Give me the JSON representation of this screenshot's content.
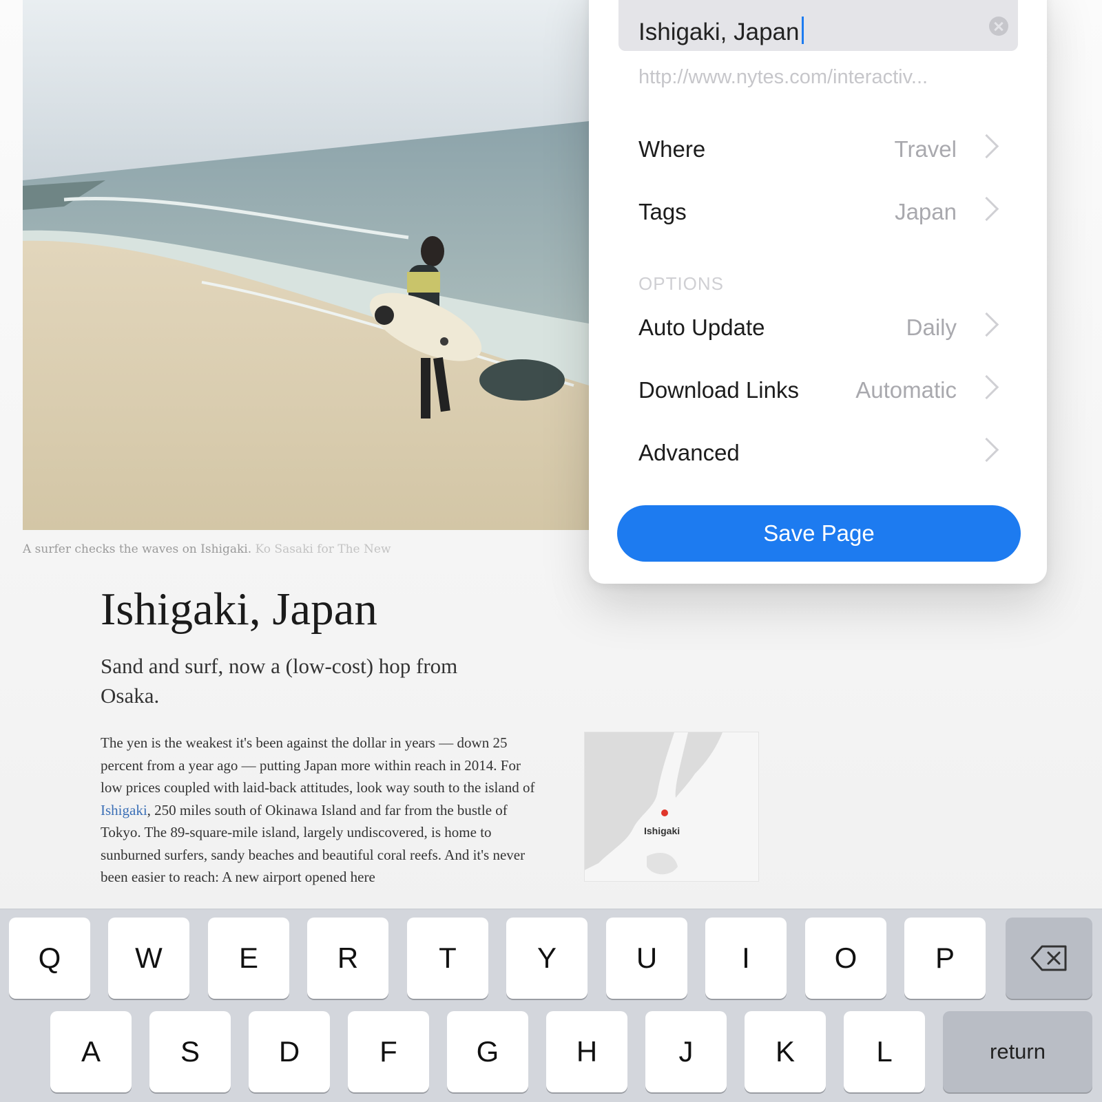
{
  "article": {
    "caption": "A surfer checks the waves on Ishigaki.",
    "caption_credit": "Ko Sasaki for The New",
    "headline": "Ishigaki, Japan",
    "subhead": "Sand and surf, now a (low-cost) hop from Osaka.",
    "body_before_link": "The yen is the weakest it's been against the dollar in years — down 25 percent from a year ago — putting Japan more within reach in 2014. For low prices coupled with laid-back attitudes, look way south to the island of ",
    "body_link": "Ishigaki",
    "body_after_link": ", 250 miles south of Okinawa Island and far from the bustle of Tokyo. The 89-square-mile island, largely undiscovered, is home to sunburned surfers, sandy beaches and beautiful coral reefs. And it's never been easier to reach: A new airport opened here",
    "map_label": "Ishigaki",
    "map_marker_color": "#e0362b"
  },
  "popover": {
    "title_value": "Ishigaki, Japan",
    "clear_icon": "clear-circle-icon",
    "url": "http://www.nytes.com/interactiv...",
    "rows": [
      {
        "label": "Where",
        "value": "Travel"
      },
      {
        "label": "Tags",
        "value": "Japan"
      }
    ],
    "options_header": "OPTIONS",
    "option_rows": [
      {
        "label": "Auto Update",
        "value": "Daily"
      },
      {
        "label": "Download Links",
        "value": "Automatic"
      },
      {
        "label": "Advanced",
        "value": ""
      }
    ],
    "save_button": "Save Page",
    "accent_color": "#1d7bf0"
  },
  "keyboard": {
    "row1": [
      "Q",
      "W",
      "E",
      "R",
      "T",
      "Y",
      "U",
      "I",
      "O",
      "P"
    ],
    "row2": [
      "A",
      "S",
      "D",
      "F",
      "G",
      "H",
      "J",
      "K",
      "L"
    ],
    "backspace_icon": "backspace-icon",
    "return_label": "return"
  }
}
